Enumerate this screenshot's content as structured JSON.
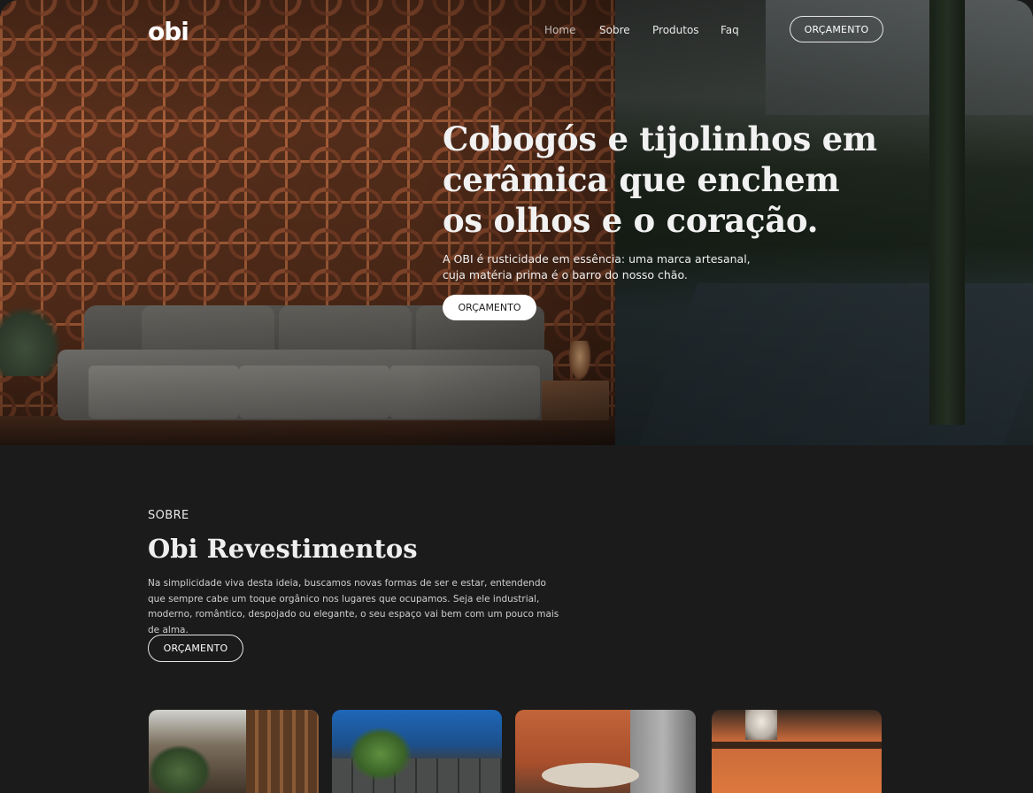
{
  "nav": {
    "logo": "obi",
    "links": [
      "Home",
      "Sobre",
      "Produtos",
      "Faq"
    ],
    "cta": "ORÇAMENTO"
  },
  "hero": {
    "title": "Cobogós e tijolinhos em cerâmica que enchem os olhos e o coração.",
    "subtitle": "A OBI é rusticidade em essência: uma marca artesanal, cuja matéria prima é o barro do nosso chão.",
    "cta": "ORÇAMENTO"
  },
  "about": {
    "eyebrow": "SOBRE",
    "title": "Obi Revestimentos",
    "text": "Na simplicidade viva desta ideia, buscamos novas formas de ser e estar, entendendo que sempre cabe um toque orgânico nos lugares que ocupamos. Seja ele industrial, moderno, romântico, despojado ou elegante, o seu espaço vai bem com um pouco mais de alma.",
    "cta": "ORÇAMENTO"
  },
  "colors": {
    "background": "#1b1b1b",
    "text": "#efefef",
    "button_bg": "#ffffff",
    "terracotta": "#9a5232"
  }
}
